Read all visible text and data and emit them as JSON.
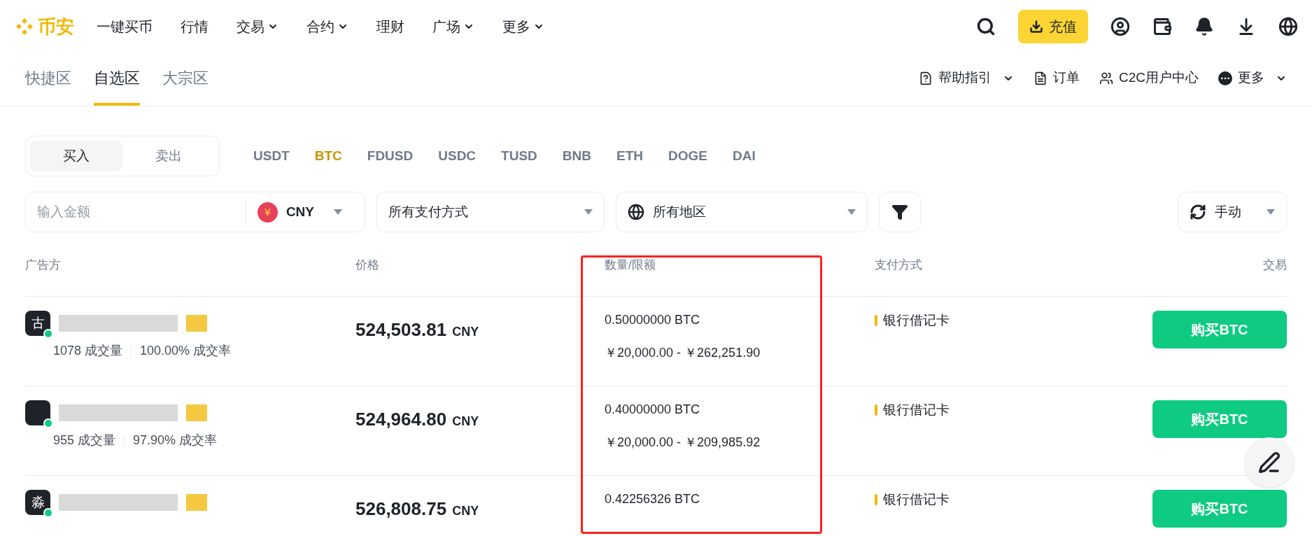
{
  "header": {
    "logo": "币安",
    "nav": [
      {
        "label": "一键买币",
        "dropdown": false
      },
      {
        "label": "行情",
        "dropdown": false
      },
      {
        "label": "交易",
        "dropdown": true
      },
      {
        "label": "合约",
        "dropdown": true
      },
      {
        "label": "理财",
        "dropdown": false
      },
      {
        "label": "广场",
        "dropdown": true
      },
      {
        "label": "更多",
        "dropdown": true
      }
    ],
    "deposit_button": "充值"
  },
  "tabs": [
    {
      "label": "快捷区",
      "selected": false
    },
    {
      "label": "自选区",
      "selected": true
    },
    {
      "label": "大宗区",
      "selected": false
    }
  ],
  "toolbar_links": [
    {
      "kind": "help",
      "label": "帮助指引",
      "dropdown": true
    },
    {
      "kind": "orders",
      "label": "订单",
      "dropdown": false
    },
    {
      "kind": "users",
      "label": "C2C用户中心",
      "dropdown": false
    },
    {
      "kind": "more",
      "label": "更多",
      "dropdown": true
    }
  ],
  "side_toggle": [
    {
      "label": "买入",
      "selected": true
    },
    {
      "label": "卖出",
      "selected": false
    }
  ],
  "coins": [
    {
      "label": "USDT",
      "selected": false
    },
    {
      "label": "BTC",
      "selected": true
    },
    {
      "label": "FDUSD",
      "selected": false
    },
    {
      "label": "USDC",
      "selected": false
    },
    {
      "label": "TUSD",
      "selected": false
    },
    {
      "label": "BNB",
      "selected": false
    },
    {
      "label": "ETH",
      "selected": false
    },
    {
      "label": "DOGE",
      "selected": false
    },
    {
      "label": "DAI",
      "selected": false
    }
  ],
  "filters": {
    "amount_placeholder": "输入金额",
    "currency_symbol": "¥",
    "currency": "CNY",
    "payment": "所有支付方式",
    "region": "所有地区",
    "refresh": "手动"
  },
  "table": {
    "columns": [
      "广告方",
      "价格",
      "数量/限额",
      "支付方式",
      "交易"
    ],
    "rows": [
      {
        "avatar": "古",
        "online": true,
        "trades": "1078 成交量",
        "completion": "100.00% 成交率",
        "price": "524,503.81",
        "price_unit": "CNY",
        "quantity": "0.50000000 BTC",
        "limit": "￥20,000.00 - ￥262,251.90",
        "payment": "银行借记卡",
        "action": "购买BTC"
      },
      {
        "avatar": "",
        "online": true,
        "trades": "955 成交量",
        "completion": "97.90% 成交率",
        "price": "524,964.80",
        "price_unit": "CNY",
        "quantity": "0.40000000 BTC",
        "limit": "￥20,000.00 - ￥209,985.92",
        "payment": "银行借记卡",
        "action": "购买BTC"
      },
      {
        "avatar": "淼",
        "online": true,
        "trades": "",
        "completion": "",
        "price": "526,808.75",
        "price_unit": "CNY",
        "quantity": "0.42256326 BTC",
        "limit": "",
        "payment": "银行借记卡",
        "action": "购买BTC"
      }
    ]
  }
}
